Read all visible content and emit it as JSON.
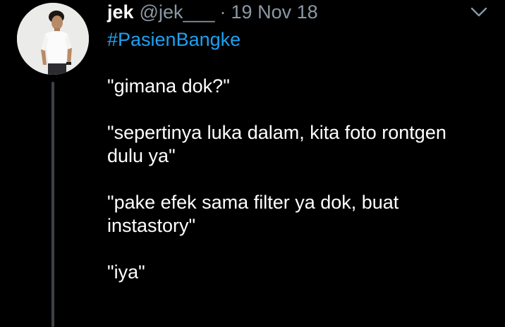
{
  "tweet": {
    "name": "jek",
    "handle": "@jek___",
    "separator": "·",
    "date": "19 Nov 18",
    "hashtag": "#PasienBangke",
    "paragraphs": [
      "\"gimana dok?\"",
      "\"sepertinya luka dalam, kita foto rontgen\ndulu ya\"",
      "\"pake efek sama filter ya dok, buat\ninstastory\"",
      "\"iya\""
    ]
  },
  "icons": {
    "avatar": "profile-photo",
    "menu": "chevron-down-icon"
  },
  "colors": {
    "background": "#000000",
    "text": "#ffffff",
    "muted": "#8b98a5",
    "link": "#1da1f2",
    "thread_line": "#3d4247"
  }
}
